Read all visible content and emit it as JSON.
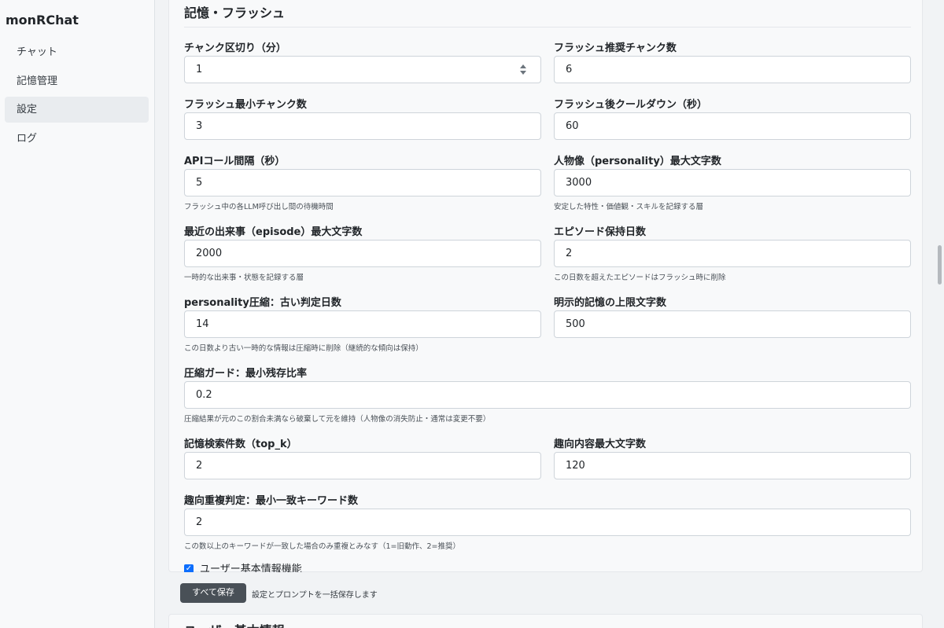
{
  "sidebar": {
    "brand": "monRChat",
    "items": [
      {
        "label": "チャット"
      },
      {
        "label": "記憶管理"
      },
      {
        "label": "設定"
      },
      {
        "label": "ログ"
      }
    ]
  },
  "section": {
    "title": "記憶・フラッシュ",
    "fields": {
      "chunk_minutes": {
        "label": "チャンク区切り（分）",
        "value": "1"
      },
      "flush_recommend": {
        "label": "フラッシュ推奨チャンク数",
        "value": "6"
      },
      "flush_min": {
        "label": "フラッシュ最小チャンク数",
        "value": "3"
      },
      "flush_cooldown": {
        "label": "フラッシュ後クールダウン（秒）",
        "value": "60"
      },
      "api_interval": {
        "label": "APIコール間隔（秒）",
        "value": "5",
        "help": "フラッシュ中の各LLM呼び出し間の待機時間"
      },
      "personality_max": {
        "label": "人物像（personality）最大文字数",
        "value": "3000",
        "help": "安定した特性・価値観・スキルを記録する層"
      },
      "episode_max": {
        "label": "最近の出来事（episode）最大文字数",
        "value": "2000",
        "help": "一時的な出来事・状態を記録する層"
      },
      "episode_days": {
        "label": "エピソード保持日数",
        "value": "2",
        "help": "この日数を超えたエピソードはフラッシュ時に削除"
      },
      "personality_old": {
        "label": "personality圧縮：古い判定日数",
        "value": "14",
        "help": "この日数より古い一時的な情報は圧縮時に削除（継続的な傾向は保持）"
      },
      "explicit_max": {
        "label": "明示的記憶の上限文字数",
        "value": "500"
      },
      "compress_guard": {
        "label": "圧縮ガード：最小残存比率",
        "value": "0.2",
        "help": "圧縮結果が元のこの割合未満なら破棄して元を維持（人物像の消失防止・通常は変更不要）"
      },
      "top_k": {
        "label": "記憶検索件数（top_k）",
        "value": "2"
      },
      "interest_max": {
        "label": "趣向内容最大文字数",
        "value": "120"
      },
      "interest_dup": {
        "label": "趣向重複判定：最小一致キーワード数",
        "value": "2",
        "help": "この数以上のキーワードが一致した場合のみ重複とみなす（1=旧動作、2=推奨）"
      }
    },
    "checkbox_label": "ユーザー基本情報機能"
  },
  "footer": {
    "save_label": "すべて保存",
    "save_note": "設定とプロンプトを一括保存します"
  },
  "next_section": {
    "title": "ユーザー基本情報"
  }
}
